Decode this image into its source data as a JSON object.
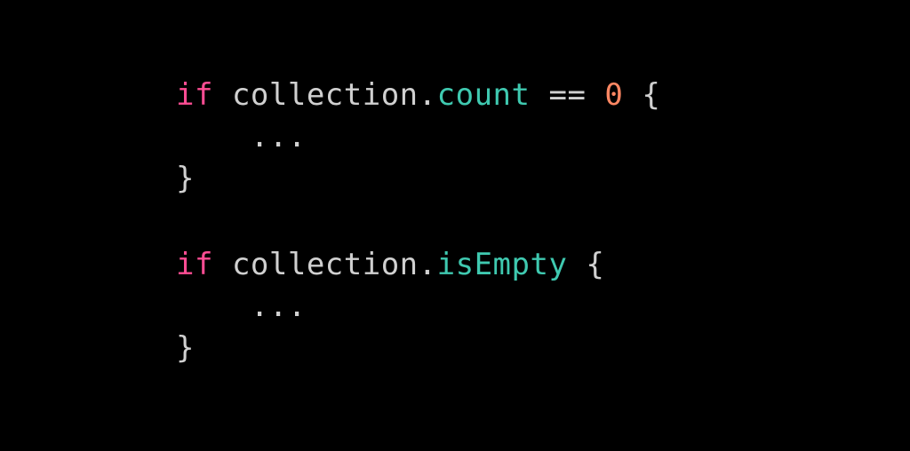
{
  "code": {
    "block1": {
      "keyword": "if",
      "space1": " ",
      "object": "collection",
      "dot": ".",
      "property": "count",
      "space2": " ",
      "operator": "==",
      "space3": " ",
      "value": "0",
      "space4": " ",
      "open_brace": "{",
      "body_indent": "    ",
      "body": "...",
      "close_brace": "}"
    },
    "block2": {
      "keyword": "if",
      "space1": " ",
      "object": "collection",
      "dot": ".",
      "property": "isEmpty",
      "space2": " ",
      "open_brace": "{",
      "body_indent": "    ",
      "body": "...",
      "close_brace": "}"
    }
  }
}
